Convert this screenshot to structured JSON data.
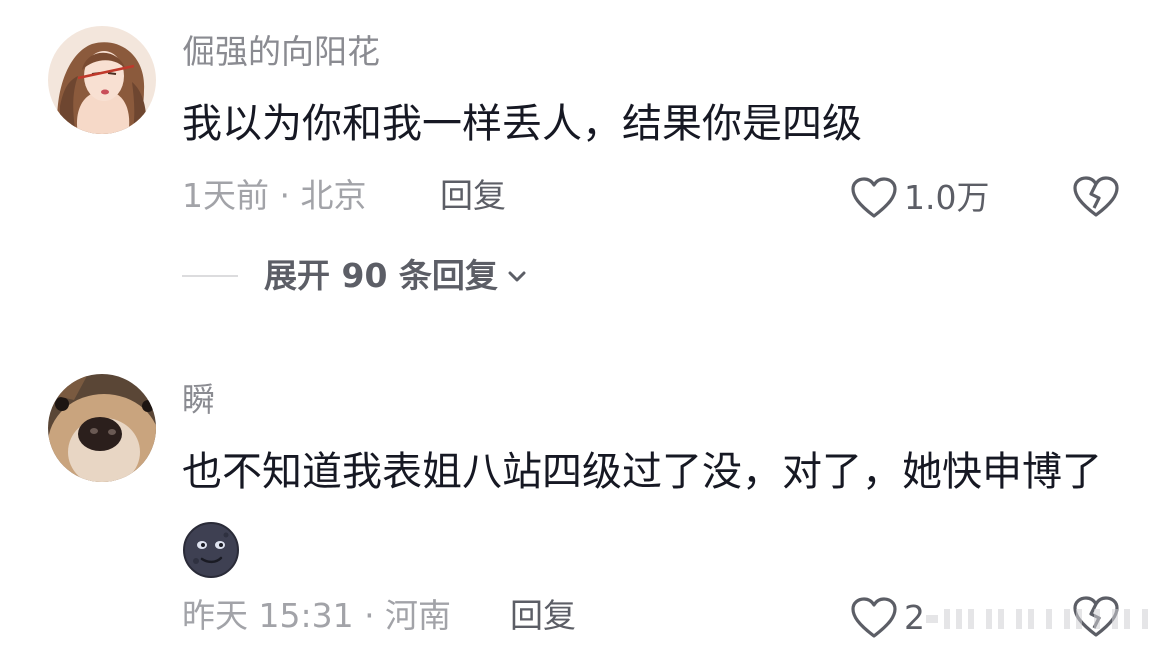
{
  "comments": [
    {
      "username": "倔强的向阳花",
      "text": "我以为你和我一样丢人，结果你是四级",
      "meta": "1天前 · 北京",
      "reply_label": "回复",
      "like_count": "1.0万",
      "expand_label": "展开 90 条回复"
    },
    {
      "username": "瞬",
      "text": "也不知道我表姐八站四级过了没，对了，她快申博了",
      "meta": "昨天 15:31 · 河南",
      "reply_label": "回复",
      "like_count": "2"
    }
  ],
  "icons": {
    "like": "heart-outline-icon",
    "dislike": "broken-heart-icon",
    "expand": "chevron-down-icon",
    "emoji": "smirk-moon-emoji"
  },
  "colors": {
    "username": "#8a8b91",
    "text": "#161823",
    "meta": "#a2a3a8",
    "action": "#5c5e66"
  }
}
